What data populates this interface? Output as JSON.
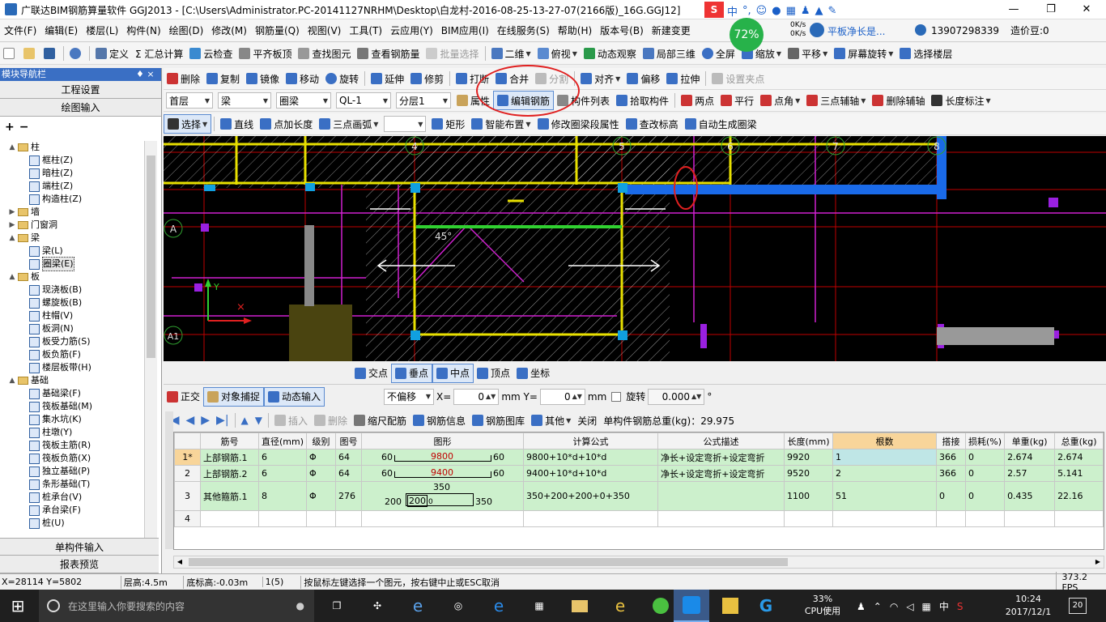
{
  "window": {
    "title": "广联达BIM钢筋算量软件 GGJ2013 - [C:\\Users\\Administrator.PC-20141127NRHM\\Desktop\\白龙村-2016-08-25-13-27-07(2166版)_16G.GGJ12]",
    "btn_min": "—",
    "btn_max": "❐",
    "btn_close": "✕",
    "cpu_badge": "72%",
    "net_up": "0K/s",
    "net_down": "0K/s",
    "ad_text": "平板净长是...",
    "ime_label": "中"
  },
  "menu": {
    "items": [
      "文件(F)",
      "编辑(E)",
      "楼层(L)",
      "构件(N)",
      "绘图(D)",
      "修改(M)",
      "钢筋量(Q)",
      "视图(V)",
      "工具(T)",
      "云应用(Y)",
      "BIM应用(I)",
      "在线服务(S)",
      "帮助(H)",
      "版本号(B)",
      "新建变更",
      "",
      ""
    ],
    "phone": "13907298339",
    "dou": "造价豆:0"
  },
  "toolbar1": {
    "items": [
      "定义",
      "Σ 汇总计算",
      "云检查",
      "平齐板顶",
      "查找图元",
      "查看钢筋量",
      "批量选择",
      "二维",
      "俯视",
      "动态观察",
      "局部三维",
      "全屏",
      "缩放",
      "平移",
      "屏幕旋转",
      "选择楼层"
    ]
  },
  "toolbar2": {
    "items": [
      "删除",
      "复制",
      "镜像",
      "移动",
      "旋转",
      "延伸",
      "修剪",
      "打断",
      "合并",
      "分割",
      "对齐",
      "偏移",
      "拉伸",
      "设置夹点"
    ]
  },
  "toolbar3": {
    "floor": "首层",
    "type": "梁",
    "sub": "圈梁",
    "name": "QL-1",
    "layer": "分层1",
    "items": [
      "属性",
      "编辑钢筋",
      "构件列表",
      "拾取构件",
      "两点",
      "平行",
      "点角",
      "三点辅轴",
      "删除辅轴",
      "长度标注"
    ]
  },
  "toolbar4": {
    "items": [
      "选择",
      "直线",
      "点加长度",
      "三点画弧",
      "矩形",
      "智能布置",
      "修改圈梁段属性",
      "查改标高",
      "自动生成圈梁"
    ]
  },
  "leftpanel": {
    "header": "模块导航栏",
    "pin": "♦ ×",
    "btn_setup": "工程设置",
    "btn_draw": "绘图输入",
    "btn_single": "单构件输入",
    "btn_report": "报表预览",
    "tree": [
      {
        "label": "柱",
        "level": 0,
        "type": "folder",
        "exp": "▲"
      },
      {
        "label": "框柱(Z)",
        "level": 1,
        "type": "leaf"
      },
      {
        "label": "暗柱(Z)",
        "level": 1,
        "type": "leaf"
      },
      {
        "label": "端柱(Z)",
        "level": 1,
        "type": "leaf"
      },
      {
        "label": "构造柱(Z)",
        "level": 1,
        "type": "leaf"
      },
      {
        "label": "墙",
        "level": 0,
        "type": "folder",
        "exp": "▶"
      },
      {
        "label": "门窗洞",
        "level": 0,
        "type": "folder",
        "exp": "▶"
      },
      {
        "label": "梁",
        "level": 0,
        "type": "folder",
        "exp": "▲"
      },
      {
        "label": "梁(L)",
        "level": 1,
        "type": "leaf"
      },
      {
        "label": "圈梁(E)",
        "level": 1,
        "type": "leaf",
        "selected": true
      },
      {
        "label": "板",
        "level": 0,
        "type": "folder",
        "exp": "▲"
      },
      {
        "label": "现浇板(B)",
        "level": 1,
        "type": "leaf"
      },
      {
        "label": "螺旋板(B)",
        "level": 1,
        "type": "leaf"
      },
      {
        "label": "柱帽(V)",
        "level": 1,
        "type": "leaf"
      },
      {
        "label": "板洞(N)",
        "level": 1,
        "type": "leaf"
      },
      {
        "label": "板受力筋(S)",
        "level": 1,
        "type": "leaf"
      },
      {
        "label": "板负筋(F)",
        "level": 1,
        "type": "leaf"
      },
      {
        "label": "楼层板带(H)",
        "level": 1,
        "type": "leaf"
      },
      {
        "label": "基础",
        "level": 0,
        "type": "folder",
        "exp": "▲"
      },
      {
        "label": "基础梁(F)",
        "level": 1,
        "type": "leaf"
      },
      {
        "label": "筏板基础(M)",
        "level": 1,
        "type": "leaf"
      },
      {
        "label": "集水坑(K)",
        "level": 1,
        "type": "leaf"
      },
      {
        "label": "柱墩(Y)",
        "level": 1,
        "type": "leaf"
      },
      {
        "label": "筏板主筋(R)",
        "level": 1,
        "type": "leaf"
      },
      {
        "label": "筏板负筋(X)",
        "level": 1,
        "type": "leaf"
      },
      {
        "label": "独立基础(P)",
        "level": 1,
        "type": "leaf"
      },
      {
        "label": "条形基础(T)",
        "level": 1,
        "type": "leaf"
      },
      {
        "label": "桩承台(V)",
        "level": 1,
        "type": "leaf"
      },
      {
        "label": "承台梁(F)",
        "level": 1,
        "type": "leaf"
      },
      {
        "label": "桩(U)",
        "level": 1,
        "type": "leaf"
      }
    ]
  },
  "canvas": {
    "axis_top": [
      "4",
      "5",
      "6",
      "7",
      "8"
    ],
    "axis_left": [
      "A",
      "A1"
    ],
    "angle": "45°",
    "axis_y": "Y"
  },
  "snap": {
    "items": [
      "交点",
      "垂点",
      "中点",
      "顶点",
      "坐标"
    ]
  },
  "edit": {
    "ortho": "正交",
    "snap": "对象捕捉",
    "dyn": "动态输入",
    "offset": "不偏移",
    "x_label": "X=",
    "x_val": "0",
    "y_label": "mm Y=",
    "y_val": "0",
    "mm": "mm",
    "rotate": "旋转",
    "rot_val": "0.000",
    "deg": "°"
  },
  "rebar": {
    "insert": "插入",
    "delete": "删除",
    "scale": "缩尺配筋",
    "info": "钢筋信息",
    "lib": "钢筋图库",
    "other": "其他",
    "close": "关闭",
    "total": "单构件钢筋总重(kg)：29.975"
  },
  "grid": {
    "headers": [
      "",
      "筋号",
      "直径(mm)",
      "级别",
      "图号",
      "图形",
      "计算公式",
      "公式描述",
      "长度(mm)",
      "根数",
      "搭接",
      "损耗(%)",
      "单重(kg)",
      "总重(kg)"
    ],
    "rows": [
      {
        "no": "1*",
        "name": "上部钢筋.1",
        "dia": "6",
        "grade": "Φ",
        "fig": "64",
        "shape_l": "60",
        "shape_m": "9800",
        "shape_r": "60",
        "formula": "9800+10*d+10*d",
        "desc": "净长+设定弯折+设定弯折",
        "len": "9920",
        "count": "1",
        "lap": "366",
        "loss": "0",
        "unit": "2.674",
        "total": "2.674"
      },
      {
        "no": "2",
        "name": "上部钢筋.2",
        "dia": "6",
        "grade": "Φ",
        "fig": "64",
        "shape_l": "60",
        "shape_m": "9400",
        "shape_r": "60",
        "formula": "9400+10*d+10*d",
        "desc": "净长+设定弯折+设定弯折",
        "len": "9520",
        "count": "2",
        "lap": "366",
        "loss": "0",
        "unit": "2.57",
        "total": "5.141"
      },
      {
        "no": "3",
        "name": "其他箍筋.1",
        "dia": "8",
        "grade": "Φ",
        "fig": "276",
        "shape_l": "200",
        "shape_m": "350",
        "shape_r": "350",
        "shape_b": "200",
        "shape_b0": "0",
        "formula": "350+200+200+0+350",
        "desc": "",
        "len": "1100",
        "count": "51",
        "lap": "0",
        "loss": "0",
        "unit": "0.435",
        "total": "22.16"
      },
      {
        "no": "4",
        "name": "",
        "dia": "",
        "grade": "",
        "fig": "",
        "shape_l": "",
        "shape_m": "",
        "shape_r": "",
        "formula": "",
        "desc": "",
        "len": "",
        "count": "",
        "lap": "",
        "loss": "",
        "unit": "",
        "total": ""
      }
    ]
  },
  "status": {
    "coord": "X=28114 Y=5802",
    "floor_h": "层高:4.5m",
    "base_h": "底标高:-0.03m",
    "sel": "1(5)",
    "hint": "按鼠标左键选择一个图元，按右键中止或ESC取消",
    "fps": "373.2 FPS"
  },
  "taskbar": {
    "search": "在这里输入你要搜索的内容",
    "cpu": "33%",
    "cpu_label": "CPU使用",
    "ime": "中",
    "time": "10:24",
    "date": "2017/12/1",
    "notif": "20"
  },
  "colors": {
    "accent": "#3a6fc4",
    "highlight_row": "#ccf0cc",
    "selected_header": "#f8d59a"
  }
}
